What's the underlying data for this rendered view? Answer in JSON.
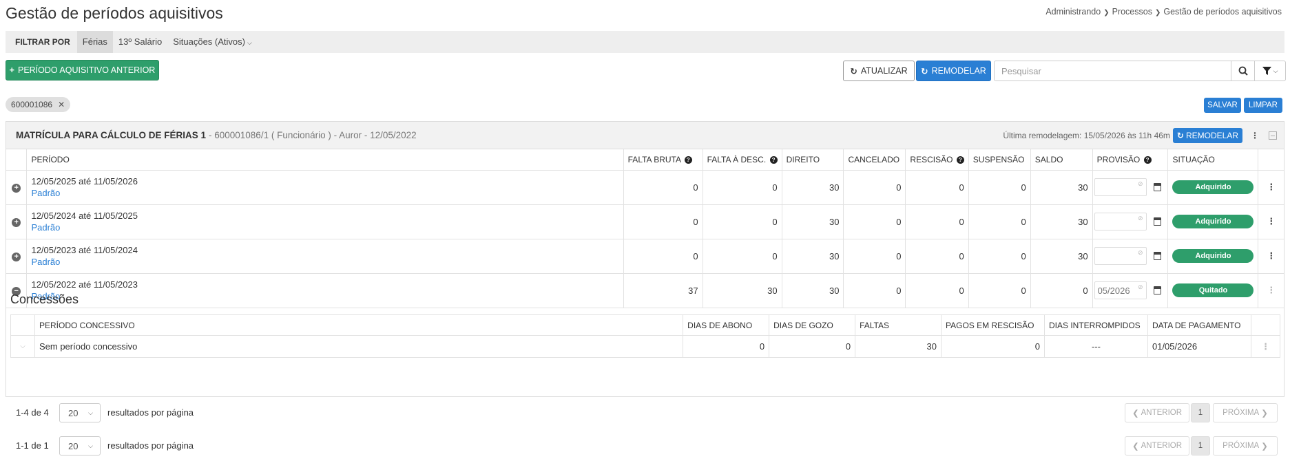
{
  "header": {
    "title": "Gestão de períodos aquisitivos",
    "breadcrumb": [
      "Administrando",
      "Processos",
      "Gestão de períodos aquisitivos"
    ]
  },
  "filter": {
    "label": "FILTRAR POR",
    "items": [
      "Férias",
      "13º Salário",
      "Situações (Ativos)"
    ]
  },
  "toolbar": {
    "prev_period_label": "PERÍODO AQUISITIVO ANTERIOR",
    "update_label": "ATUALIZAR",
    "remodel_label": "REMODELAR",
    "search_placeholder": "Pesquisar"
  },
  "chip": {
    "label": "600001086"
  },
  "actions": {
    "save_label": "SALVAR",
    "clear_label": "LIMPAR"
  },
  "panel": {
    "title": "MATRÍCULA PARA CÁLCULO DE FÉRIAS 1",
    "subtitle": "- 600001086/1 ( Funcionário ) - Auror - 12/05/2022",
    "last_remodel": "Última remodelagem: 15/05/2026 às 11h 46m",
    "remodel_label": "REMODELAR"
  },
  "periods_table": {
    "columns": [
      "PERÍODO",
      "FALTA BRUTA",
      "FALTA À DESC.",
      "DIREITO",
      "CANCELADO",
      "RESCISÃO",
      "SUSPENSÃO",
      "SALDO",
      "PROVISÃO",
      "SITUAÇÃO"
    ],
    "rows": [
      {
        "period": "12/05/2025 até 11/05/2026",
        "type": "Padrão",
        "falta_bruta": "0",
        "falta_desc": "0",
        "direito": "30",
        "cancelado": "0",
        "rescisao": "0",
        "suspensao": "0",
        "saldo": "30",
        "provisao": "",
        "situacao": "Adquirido"
      },
      {
        "period": "12/05/2024 até 11/05/2025",
        "type": "Padrão",
        "falta_bruta": "0",
        "falta_desc": "0",
        "direito": "30",
        "cancelado": "0",
        "rescisao": "0",
        "suspensao": "0",
        "saldo": "30",
        "provisao": "",
        "situacao": "Adquirido"
      },
      {
        "period": "12/05/2023 até 11/05/2024",
        "type": "Padrão",
        "falta_bruta": "0",
        "falta_desc": "0",
        "direito": "30",
        "cancelado": "0",
        "rescisao": "0",
        "suspensao": "0",
        "saldo": "30",
        "provisao": "",
        "situacao": "Adquirido"
      },
      {
        "period": "12/05/2022 até 11/05/2023",
        "type": "Padrão",
        "falta_bruta": "37",
        "falta_desc": "30",
        "direito": "30",
        "cancelado": "0",
        "rescisao": "0",
        "suspensao": "0",
        "saldo": "0",
        "provisao": "05/2026",
        "situacao": "Quitado"
      }
    ]
  },
  "concessions": {
    "title": "Concessões",
    "columns": [
      "PERÍODO CONCESSIVO",
      "DIAS DE ABONO",
      "DIAS DE GOZO",
      "FALTAS",
      "PAGOS EM RESCISÃO",
      "DIAS INTERROMPIDOS",
      "DATA DE PAGAMENTO"
    ],
    "rows": [
      {
        "period": "Sem período concessivo",
        "abono": "0",
        "gozo": "0",
        "faltas": "30",
        "pagos": "0",
        "interrompidos": "---",
        "data": "01/05/2026"
      }
    ]
  },
  "pagers": [
    {
      "count": "1-4 de 4",
      "per_page": "20",
      "per_label": "resultados por página",
      "prev": "ANTERIOR",
      "page": "1",
      "next": "PRÓXIMA"
    },
    {
      "count": "1-1 de 1",
      "per_page": "20",
      "per_label": "resultados por página",
      "prev": "ANTERIOR",
      "page": "1",
      "next": "PRÓXIMA"
    }
  ],
  "colors": {
    "green": "#2e9e6b",
    "blue": "#2a7fd4"
  }
}
